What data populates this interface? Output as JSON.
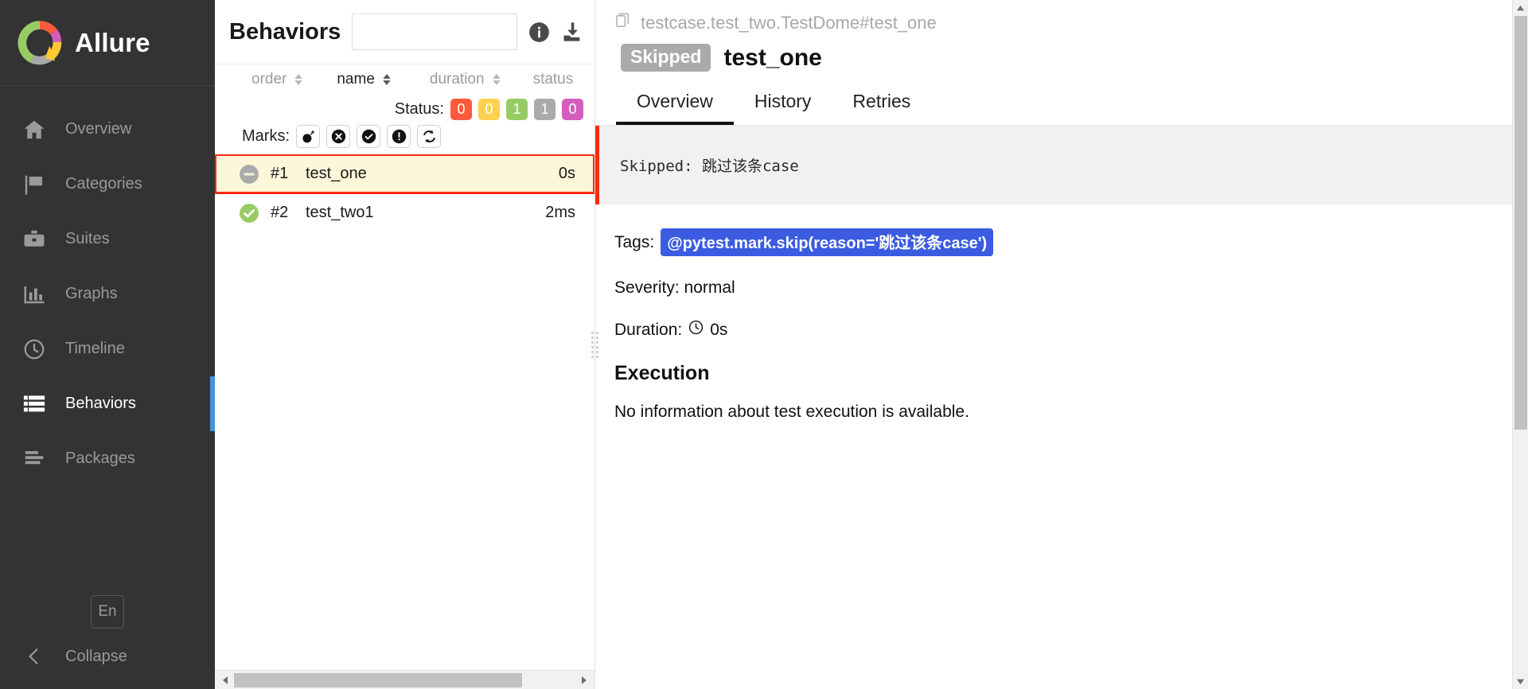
{
  "brand": {
    "name": "Allure",
    "logo_icon": "allure-donut-logo"
  },
  "sidebar": {
    "items": [
      {
        "label": "Overview",
        "icon": "home-icon",
        "active": false
      },
      {
        "label": "Categories",
        "icon": "flag-icon",
        "active": false
      },
      {
        "label": "Suites",
        "icon": "briefcase-icon",
        "active": false
      },
      {
        "label": "Graphs",
        "icon": "bar-chart-icon",
        "active": false
      },
      {
        "label": "Timeline",
        "icon": "clock-icon",
        "active": false
      },
      {
        "label": "Behaviors",
        "icon": "list-icon",
        "active": true
      },
      {
        "label": "Packages",
        "icon": "packages-icon",
        "active": false
      }
    ],
    "language": "En",
    "collapse_label": "Collapse",
    "collapse_icon": "chevron-left-icon"
  },
  "list_panel": {
    "title": "Behaviors",
    "search_value": "",
    "search_placeholder": "",
    "info_icon": "info-icon",
    "download_icon": "download-icon",
    "columns": [
      {
        "label": "order",
        "selected": false
      },
      {
        "label": "name",
        "selected": true
      },
      {
        "label": "duration",
        "selected": false
      },
      {
        "label": "status",
        "selected": false
      }
    ],
    "status_label": "Status:",
    "status_counts": [
      {
        "value": "0",
        "color": "#fd5a3e",
        "name": "failed"
      },
      {
        "value": "0",
        "color": "#ffd050",
        "name": "broken"
      },
      {
        "value": "1",
        "color": "#97cc64",
        "name": "passed"
      },
      {
        "value": "1",
        "color": "#aaaaaa",
        "name": "skipped"
      },
      {
        "value": "0",
        "color": "#d35ebe",
        "name": "unknown"
      }
    ],
    "marks_label": "Marks:",
    "marks": [
      {
        "name": "flaky-mark",
        "glyph": "bomb"
      },
      {
        "name": "failed-mark",
        "glyph": "x-circle"
      },
      {
        "name": "passed-mark",
        "glyph": "check-circle"
      },
      {
        "name": "broken-mark",
        "glyph": "exclamation-circle"
      },
      {
        "name": "retry-mark",
        "glyph": "refresh"
      }
    ],
    "rows": [
      {
        "order": "#1",
        "name": "test_one",
        "duration": "0s",
        "status": "skipped",
        "selected": true
      },
      {
        "order": "#2",
        "name": "test_two1",
        "duration": "2ms",
        "status": "passed",
        "selected": false
      }
    ]
  },
  "detail": {
    "breadcrumb": "testcase.test_two.TestDome#test_one",
    "breadcrumb_icon": "copy-icon",
    "status_badge": "Skipped",
    "title": "test_one",
    "tabs": [
      {
        "label": "Overview",
        "active": true
      },
      {
        "label": "History",
        "active": false
      },
      {
        "label": "Retries",
        "active": false
      }
    ],
    "message": "Skipped: 跳过该条case",
    "tags_label": "Tags:",
    "tag_value": "@pytest.mark.skip(reason='跳过该条case')",
    "severity": "Severity: normal",
    "duration_label": "Duration:",
    "duration_icon": "clock-icon",
    "duration_value": "0s",
    "execution_heading": "Execution",
    "execution_text": "No information about test execution is available."
  },
  "colors": {
    "sidebar_bg": "#333333",
    "accent_blue": "#4a90d9",
    "selection_outline": "#fc2a0e",
    "selection_bg": "#fdf6d8",
    "tag_blue": "#3b5ce0"
  }
}
